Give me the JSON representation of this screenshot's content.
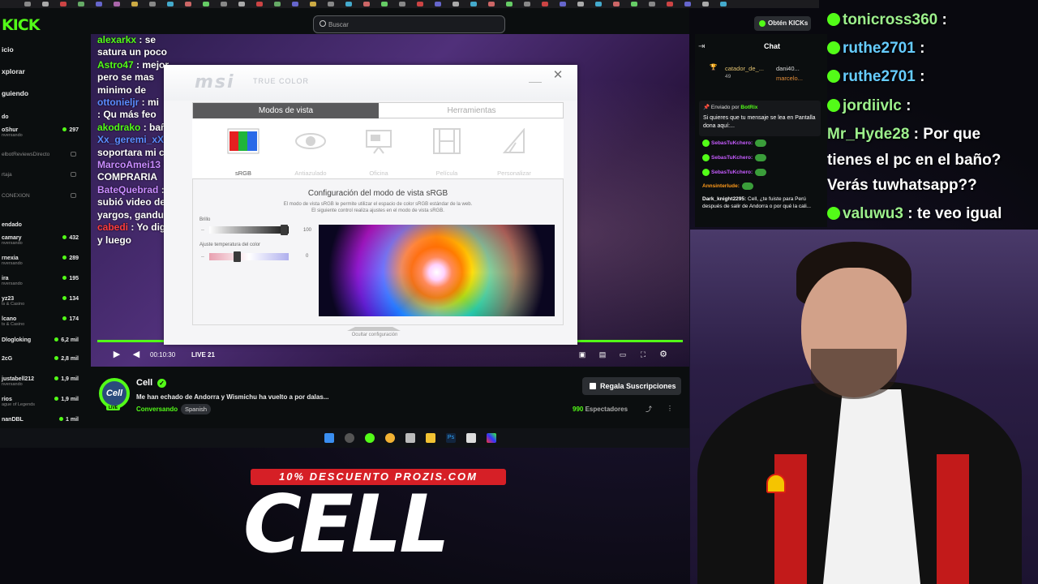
{
  "kick": {
    "logo": "KICK",
    "search_placeholder": "Buscar",
    "kicks_button": "Obtén KICKs",
    "nav": [
      "icio",
      "xplorar",
      "guiendo"
    ],
    "section_following": "do",
    "section_recommended": "endado",
    "following": [
      {
        "name": "oShur",
        "sub": "nversando",
        "viewers": "297"
      },
      {
        "name": "elbotReviewsDirecto",
        "sub": "",
        "viewers": ""
      },
      {
        "name": "rtaja",
        "sub": "",
        "viewers": ""
      },
      {
        "name": "CONEXION",
        "sub": "",
        "viewers": ""
      }
    ],
    "recommended": [
      {
        "name": "camary",
        "sub": "nversando",
        "viewers": "432"
      },
      {
        "name": "rnexia",
        "sub": "nversando",
        "viewers": "289"
      },
      {
        "name": "ira",
        "sub": "nversando",
        "viewers": "195"
      },
      {
        "name": "yz23",
        "sub": "ts & Casino",
        "viewers": "134"
      },
      {
        "name": "lcano",
        "sub": "ts & Casino",
        "viewers": "174"
      },
      {
        "name": "Dlogloking",
        "sub": "",
        "viewers": "6,2 mil"
      },
      {
        "name": "2cG",
        "sub": "",
        "viewers": "2,8 mil"
      },
      {
        "name": "justabell212",
        "sub": "nversando",
        "viewers": "1,9 mil"
      },
      {
        "name": "rios",
        "sub": "ague of Legends",
        "viewers": "1,9 mil"
      },
      {
        "name": "nanDBL",
        "sub": "",
        "viewers": "1 mil"
      }
    ]
  },
  "stream_chat": [
    {
      "user": "alexarkx",
      "text": ": se satura un poco"
    },
    {
      "user": "Astro47",
      "text": ": mejor pero se mas minimo de"
    },
    {
      "user": "ottonieljr",
      "text": ": mi"
    },
    {
      "user": "",
      "text": ": Qu más feo"
    },
    {
      "user": "akodrako",
      "text": ": baño"
    },
    {
      "user": "Xx_geremi_xX",
      "text": ": soportara mi c"
    },
    {
      "user": "MarcoAmei13",
      "text": ": COMPRARIA"
    },
    {
      "user": "BateQuebrad",
      "text": ": subió video de yargos, gandu"
    },
    {
      "user": "cabedi",
      "text": ": Yo digo y luego"
    }
  ],
  "player": {
    "time": "00:10:30",
    "live_label": "LIVE 21",
    "progress": 1.0
  },
  "msi": {
    "logo": "msi",
    "subtitle": "TRUE COLOR",
    "tabs": [
      "Modos de vista",
      "Herramientas"
    ],
    "modes": [
      "sRGB",
      "Antiazulado",
      "Oficina",
      "Película",
      "Personalizar"
    ],
    "config_title": "Configuración del modo de vista sRGB",
    "config_desc1": "El modo de vista sRGB le permite utilizar el espacio de color sRGB estándar de la web.",
    "config_desc2": "El siguiente control realiza ajustes en el modo de vista sRGB.",
    "brightness_label": "Brillo",
    "brightness_value": "100",
    "temp_label": "Ajuste temperatura del color",
    "temp_value": "0",
    "hide_label": "Ocultar configuración"
  },
  "streamer": {
    "avatar_text": "Cell",
    "live_badge": "LIVE",
    "name": "Cell",
    "title": "Me han echado de Andorra y Wismichu ha vuelto a por dalas...",
    "category": "Conversando",
    "language": "Spanish",
    "gift_button": "Regala Suscripciones",
    "viewers": "990",
    "viewers_label": "Espectadores"
  },
  "chat": {
    "title": "Chat",
    "gifter1": "catador_de_...",
    "gifter1_count": "49",
    "gifter2": "dani40...",
    "gifter3": "marcelo...",
    "pinned_by": "Enviado por",
    "pinned_user": "BotRix",
    "pinned_text": "Si quieres que tu mensaje se lea en Pantalla dona aquí:...",
    "messages": [
      {
        "user": "SebasTuKchero:",
        "text": ""
      },
      {
        "user": "SebasTuKchero:",
        "text": ""
      },
      {
        "user": "SebasTuKchero:",
        "text": ""
      },
      {
        "user": "Annsinterlude:",
        "text": ""
      },
      {
        "user": "Dark_knight2295:",
        "text": "Cell, ¿te fuiste para Perú después de salir de Andorra o por qué la cali..."
      }
    ],
    "x10": "x10"
  },
  "overlay_chat": [
    {
      "user": "tonicross360",
      "text": ":"
    },
    {
      "user": "ruthe2701",
      "text": ":"
    },
    {
      "user": "ruthe2701",
      "text": ":"
    },
    {
      "user": "jordiivlc",
      "text": ":"
    },
    {
      "user": "Mr_Hyde28",
      "text": ": Por que"
    },
    {
      "user": "",
      "text": "tienes el pc en el baño?"
    },
    {
      "user": "",
      "text": "Verás tuwhatsapp??"
    },
    {
      "user": "valuwu3",
      "text": ": te veo igual"
    }
  ],
  "promo": {
    "line": "10% DESCUENTO PROZIS.COM",
    "big": "CELL"
  },
  "colors": {
    "kick_green": "#53fc18",
    "promo_red": "#d61f26"
  }
}
